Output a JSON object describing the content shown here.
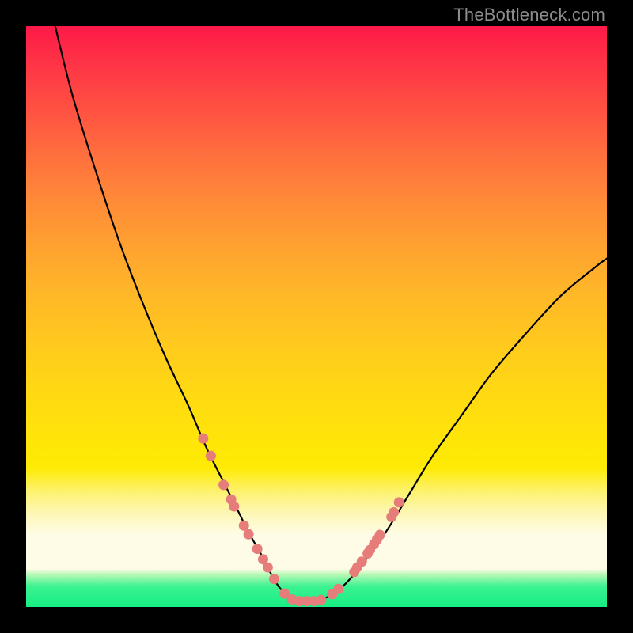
{
  "watermark": "TheBottleneck.com",
  "colors": {
    "frame": "#000000",
    "gradient_top": "#fe1948",
    "gradient_mid": "#ffd714",
    "gradient_white": "#fefce6",
    "gradient_green": "#17ee84",
    "curve_stroke": "#000000",
    "markers": "#e67d7a"
  },
  "chart_data": {
    "type": "line",
    "title": "",
    "xlabel": "",
    "ylabel": "",
    "xlim": [
      0,
      100
    ],
    "ylim": [
      0,
      100
    ],
    "grid": false,
    "series": [
      {
        "name": "bottleneck-curve",
        "x": [
          5,
          8,
          12,
          16,
          20,
          24,
          28,
          31,
          34,
          36.5,
          38.5,
          40.5,
          42,
          43.5,
          45,
          47,
          49.5,
          52.5,
          55,
          58,
          62,
          66,
          70,
          75,
          80,
          86,
          92,
          98,
          100
        ],
        "y": [
          100,
          88,
          75,
          63,
          52.5,
          43,
          34.5,
          27.5,
          21.5,
          16.5,
          12.5,
          9,
          6,
          3.5,
          2,
          1,
          1,
          2,
          4,
          7.5,
          13,
          19.5,
          26,
          33,
          40,
          47,
          53.5,
          58.5,
          60
        ]
      }
    ],
    "markers": {
      "name": "sample-points",
      "points": [
        {
          "x": 30.5,
          "y": 29
        },
        {
          "x": 31.8,
          "y": 26
        },
        {
          "x": 34.0,
          "y": 21
        },
        {
          "x": 35.3,
          "y": 18.5
        },
        {
          "x": 35.8,
          "y": 17.3
        },
        {
          "x": 37.5,
          "y": 14
        },
        {
          "x": 38.3,
          "y": 12.5
        },
        {
          "x": 39.8,
          "y": 10
        },
        {
          "x": 40.8,
          "y": 8.2
        },
        {
          "x": 41.6,
          "y": 6.8
        },
        {
          "x": 42.7,
          "y": 4.8
        },
        {
          "x": 44.5,
          "y": 2.3
        },
        {
          "x": 45.8,
          "y": 1.3
        },
        {
          "x": 47.0,
          "y": 1.0
        },
        {
          "x": 48.3,
          "y": 1.0
        },
        {
          "x": 49.6,
          "y": 1.0
        },
        {
          "x": 50.8,
          "y": 1.2
        },
        {
          "x": 52.7,
          "y": 2.2
        },
        {
          "x": 53.8,
          "y": 3.1
        },
        {
          "x": 56.5,
          "y": 6.0
        },
        {
          "x": 57.0,
          "y": 6.8
        },
        {
          "x": 57.8,
          "y": 7.8
        },
        {
          "x": 58.8,
          "y": 9.2
        },
        {
          "x": 59.2,
          "y": 9.8
        },
        {
          "x": 59.9,
          "y": 10.8
        },
        {
          "x": 60.4,
          "y": 11.6
        },
        {
          "x": 60.9,
          "y": 12.4
        },
        {
          "x": 62.9,
          "y": 15.5
        },
        {
          "x": 63.3,
          "y": 16.3
        },
        {
          "x": 64.2,
          "y": 18.0
        }
      ]
    }
  }
}
